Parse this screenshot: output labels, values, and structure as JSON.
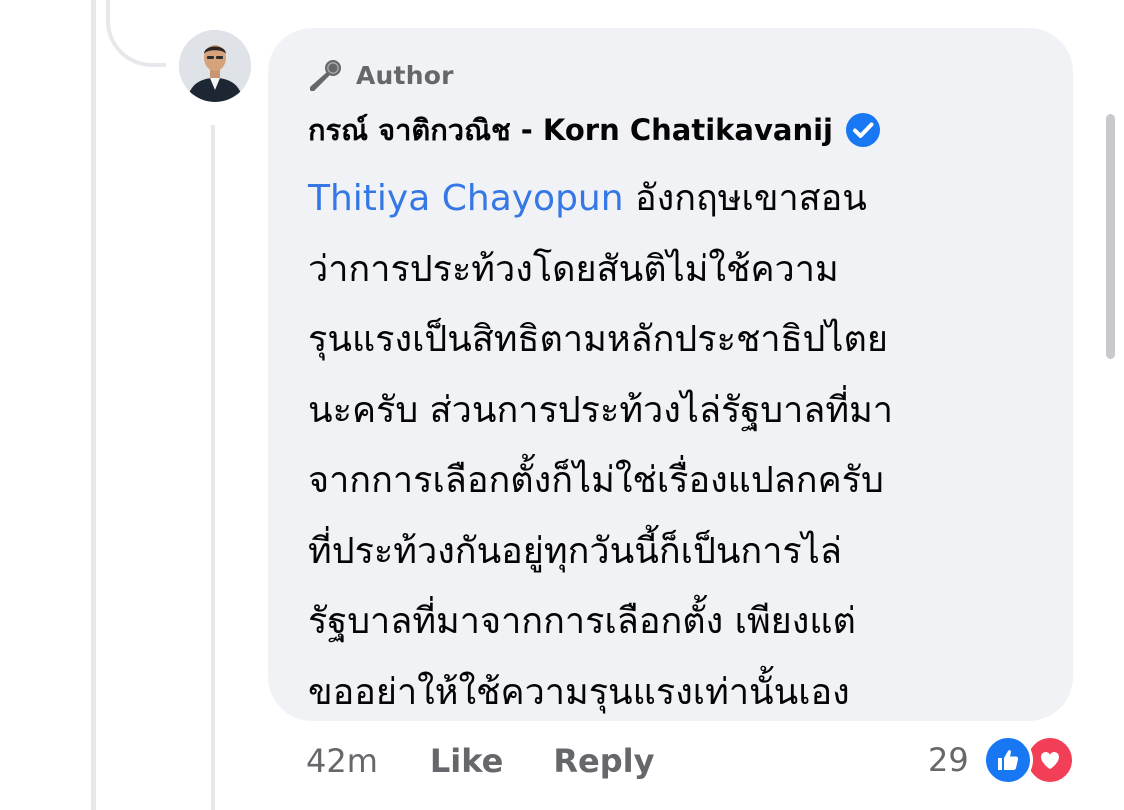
{
  "comment": {
    "badge_icon": "microphone-icon",
    "badge_label": "Author",
    "author_name": "กรณ์ จาติกวณิช - Korn Chatikavanij",
    "verified_icon": "verified-check-icon",
    "mention": "Thitiya Chayopun",
    "text_lines": [
      " อังกฤษเขาสอน",
      "ว่าการประท้วงโดยสันติไม่ใช้ความ",
      "รุนแรงเป็นสิทธิตามหลักประชาธิปไตย",
      "นะครับ ส่วนการประท้วงไล่รัฐบาลที่มา",
      "จากการเลือกตั้งก็ไม่ใช่เรื่องแปลกครับ",
      "ที่ประท้วงกันอยู่ทุกวันนี้ก็เป็นการไล่",
      "รัฐบาลที่มาจากการเลือกตั้ง เพียงแต่",
      "ขออย่าให้ใช้ความรุนแรงเท่านั้นเอง"
    ]
  },
  "actions": {
    "timestamp": "42m",
    "like_label": "Like",
    "reply_label": "Reply"
  },
  "reactions": {
    "count": "29",
    "icons": [
      "like-reaction-icon",
      "love-reaction-icon"
    ],
    "like_color": "#1877f2",
    "love_color": "#f33e58"
  },
  "colors": {
    "bubble_bg": "#f0f2f5",
    "mention": "#3578e5",
    "verified": "#1877f2",
    "secondary_text": "#65676b"
  }
}
